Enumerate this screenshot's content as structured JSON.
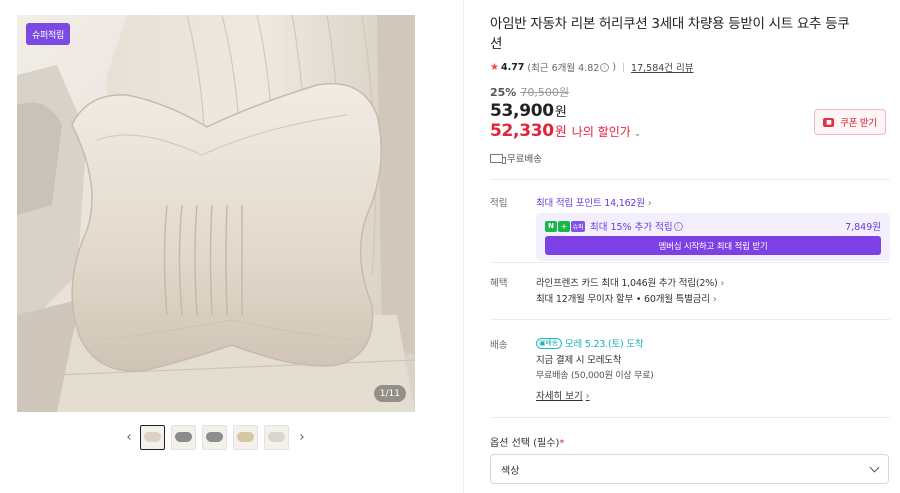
{
  "gallery": {
    "badge": "슈퍼적립",
    "counter": "1/11",
    "prev": "‹",
    "next": "›",
    "thumb_colors": [
      "#dcd3c4",
      "#8b8b8b",
      "#8e8e8e",
      "#d8c7a5",
      "#d9d6cf"
    ]
  },
  "product": {
    "title": "아임반 자동차 리본 허리쿠션 3세대 차량용 등받이 시트 요추 등쿠션",
    "rating": "4.77",
    "rating_sub": "(최근 6개월 4.82",
    "rating_close": ")",
    "reviews": "17,584건 리뷰",
    "discount": "25%",
    "original_price": "70,500원",
    "price": "53,900",
    "won": "원",
    "my_price": "52,330",
    "my_price_label": "나의 할인가",
    "coupon": "쿠폰 받기",
    "shipping_fee": "무료배송"
  },
  "points": {
    "label": "적립",
    "max_points": "최대 적립 포인트 14,162원",
    "np_logo": "N",
    "np_plus": "+",
    "np_super": "슈퍼",
    "extra_text": "최대 15% 추가 적립",
    "extra_value": "7,849원",
    "member_button": "멤버십 시작하고 최대 적립 받기"
  },
  "benefits": {
    "label": "혜택",
    "line1": "라인프렌즈 카드 최대 1,046원 추가 적립(2%)",
    "line2": "최대 12개월 무이자 할부 • 60개월 특별금리"
  },
  "delivery": {
    "label": "배송",
    "badge": "배송",
    "arrival": "모레 5.23.(토) 도착",
    "line2": "지금 결제 시 모레도착",
    "line3": "무료배송 (50,000원 이상 무료)",
    "detail_link": "자세히 보기"
  },
  "options": {
    "label": "옵션 선택 (필수)",
    "required_mark": "*",
    "select_value": "색상"
  },
  "colors": {
    "accent_purple": "#7c40e4",
    "price_red": "#e52339",
    "teal": "#1aaeb9"
  }
}
